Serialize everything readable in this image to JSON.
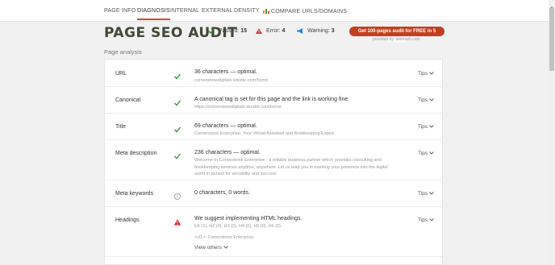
{
  "nav": {
    "tabs": [
      {
        "label": "PAGE INFO"
      },
      {
        "label": "DIAGNOSIS"
      },
      {
        "label": "INTERNAL"
      },
      {
        "label": "EXTERNAL"
      },
      {
        "label": "DENSITY"
      },
      {
        "label": "COMPARE URLS/DOMAINS",
        "icon": "bar-chart-icon"
      }
    ],
    "active_tab": "DIAGNOSIS"
  },
  "header": {
    "title": "PAGE SEO AUDIT",
    "passed_label": "Passed:",
    "passed_count": "15",
    "error_label": "Error:",
    "error_count": "4",
    "warning_label": "Warning:",
    "warning_count": "3",
    "cta_label": "Get 100-pages audit for FREE in 5 minutes",
    "provided_by": "provided by  semrush.com"
  },
  "section_label": "Page analysis",
  "colors": {
    "accent": "#d64a2b",
    "cta": "#c3401f",
    "title": "#3e4a33",
    "pass": "#2e8b3a",
    "error": "#d32f2f",
    "warning": "#1e88e5",
    "info": "#9e9e9e"
  },
  "rows": [
    {
      "label": "URL",
      "status": "pass",
      "main": "36 characters — optimal.",
      "sub": [
        "cornerstonedigitals.wixsite.com/home"
      ],
      "tips": "Tips"
    },
    {
      "label": "Canonical",
      "status": "pass",
      "main": "A canonical tag is set for this page and the link is working fine.",
      "sub": [
        "https://cornerstonedigitals.wixsite.com/home"
      ],
      "tips": "Tips"
    },
    {
      "label": "Title",
      "status": "pass",
      "main": "69 characters — optimal.",
      "sub": [
        "Cornerstone Enterprise: Your Virtual Assistant and Bookkeeping Expert"
      ],
      "tips": "Tips"
    },
    {
      "label": "Meta description",
      "status": "pass",
      "main": "236 characters — optimal.",
      "sub": [
        "Welcome to Cornerstone Enterprise - a reliable business partner which provides consulting and",
        "bookkeeping services anytime, anywhere. Let us lead you in marking your presence into the digital",
        "world in pursuit for versatility and success"
      ],
      "tips": "Tips"
    },
    {
      "label": "Meta keywords",
      "status": "info",
      "main": "0 characters, 0 words.",
      "sub": [],
      "tips": "Tips"
    },
    {
      "label": "Headings",
      "status": "error",
      "main": "We suggest implementing HTML headings.",
      "sub": [
        "H1 (1), H2 (4), H3 (0), H4 (0), H5 (0), H6 (0)",
        "",
        "<H1>: Cornerstone Enterprise"
      ],
      "tips": "Tips",
      "view_others": "View others"
    }
  ]
}
